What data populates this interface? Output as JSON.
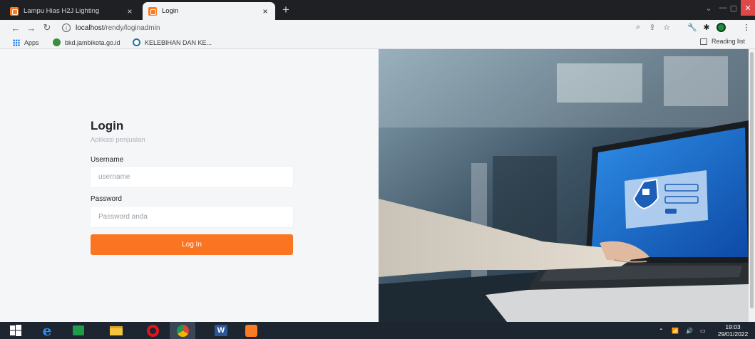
{
  "browser": {
    "tabs": [
      {
        "title": "Lampu Hias H2J Lighting",
        "active": false
      },
      {
        "title": "Login",
        "active": true
      }
    ],
    "new_tab": "+",
    "address": {
      "host": "localhost",
      "path": "/rendy/loginadmin"
    },
    "bookmarks": [
      {
        "label": "Apps",
        "icon": "apps-grid-icon"
      },
      {
        "label": "bkd.jambikota.go.id",
        "icon": "site-logo-icon"
      },
      {
        "label": "KELEBIHAN DAN KE...",
        "icon": "wordpress-icon"
      }
    ],
    "reading_list": "Reading list"
  },
  "login": {
    "title": "Login",
    "subtitle": "Aplikasi penjualan",
    "username_label": "Username",
    "username_placeholder": "username",
    "password_label": "Password",
    "password_placeholder": "Password anda",
    "button_label": "Log In"
  },
  "taskbar": {
    "time": "19:03",
    "date": "29/01/2022"
  },
  "colors": {
    "accent": "#fb7421",
    "page_bg": "#f5f6f8",
    "tab_bar": "#1f2023",
    "taskbar": "#1c2530"
  }
}
